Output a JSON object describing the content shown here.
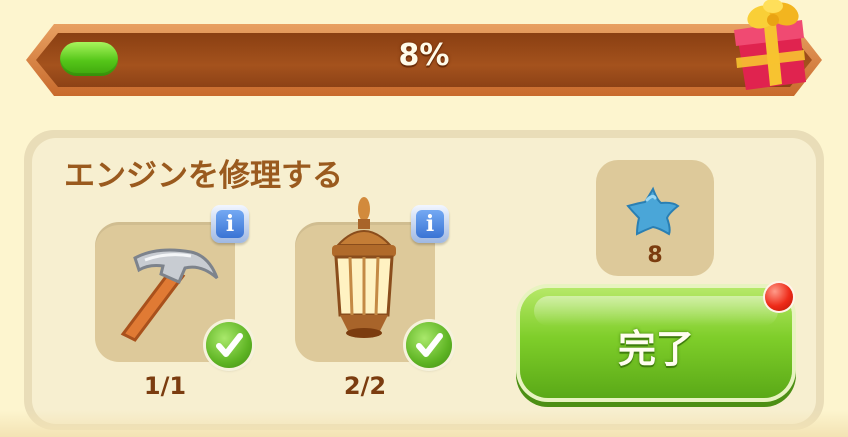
{
  "progress": {
    "label": "8%",
    "value": 0.08,
    "fill_color": "#55c619"
  },
  "reward_chest": {
    "icon": "gift-box-icon"
  },
  "task": {
    "title": "エンジンを修理する",
    "items": [
      {
        "icon": "hammer-icon",
        "count": "1/1",
        "complete": true,
        "info_label": "i"
      },
      {
        "icon": "lantern-icon",
        "count": "2/2",
        "complete": true,
        "info_label": "i"
      }
    ]
  },
  "reward": {
    "icon": "blue-star-icon",
    "amount": "8"
  },
  "complete_button": {
    "label": "完了",
    "notification": true
  }
}
